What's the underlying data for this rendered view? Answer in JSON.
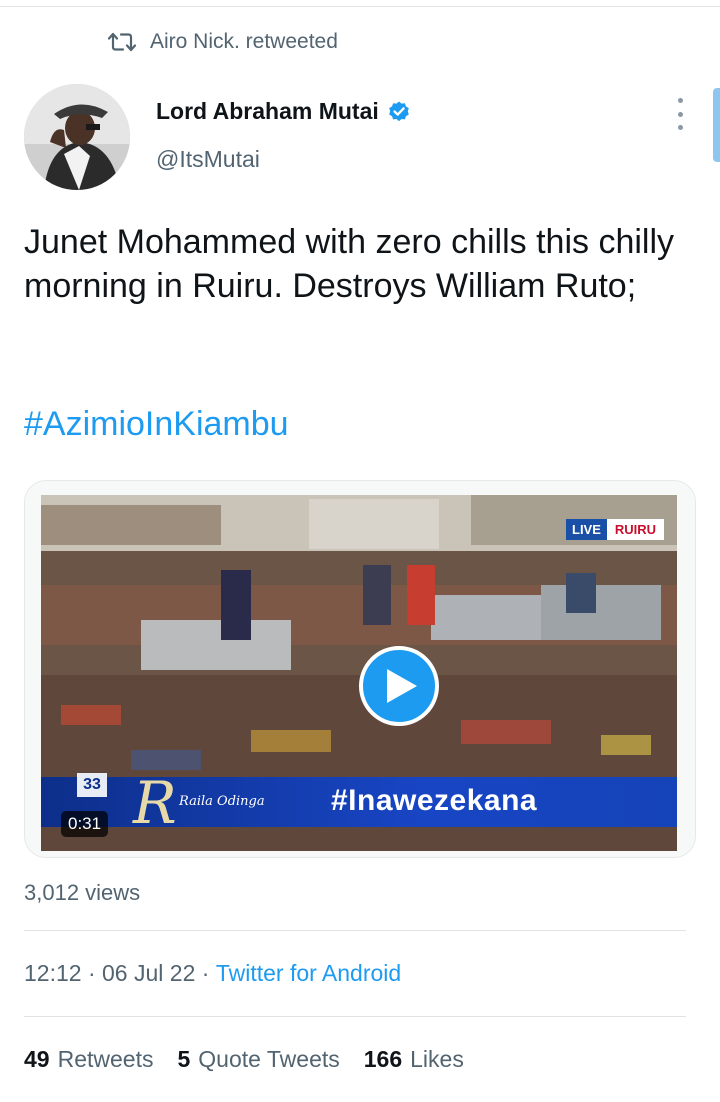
{
  "social_context": {
    "text": "Airo Nick. retweeted",
    "icon": "retweet-icon"
  },
  "author": {
    "name": "Lord Abraham Mutai",
    "handle": "@ItsMutai",
    "verified_icon": "verified-badge-icon"
  },
  "tweet": {
    "text": "Junet Mohammed with zero chills this chilly morning in Ruiru. Destroys William Ruto;",
    "hashtag": "#AzimioInKiambu"
  },
  "media": {
    "duration": "0:31",
    "play_icon": "play-icon",
    "overlay": {
      "live_label": "LIVE",
      "location": "RUIRU",
      "banner_hashtag": "#Inawezekana",
      "presenter": "Raila Odinga",
      "logo_letter": "R",
      "channel_number": "33"
    }
  },
  "views": "3,012 views",
  "meta": {
    "time": "12:12",
    "separator": " · ",
    "date": "06 Jul 22",
    "source": "Twitter for Android"
  },
  "stats": [
    {
      "value": "49",
      "label": "Retweets"
    },
    {
      "value": "5",
      "label": "Quote Tweets"
    },
    {
      "value": "166",
      "label": "Likes"
    }
  ],
  "colors": {
    "accent": "#1d9bf0",
    "secondary_text": "#536471",
    "primary_text": "#0f1419"
  }
}
